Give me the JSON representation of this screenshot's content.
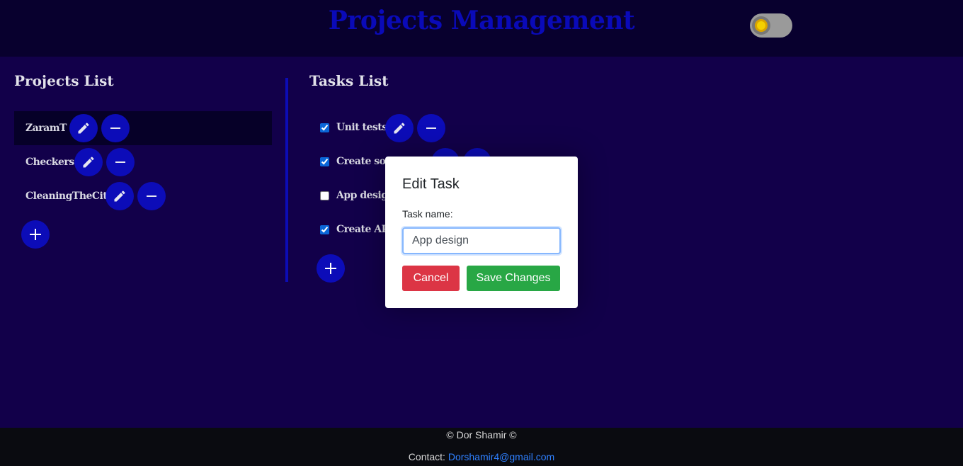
{
  "header": {
    "title": "Projects Management"
  },
  "theme_toggle": {
    "icon": "sun-icon",
    "state": "off"
  },
  "projects": {
    "title": "Projects List",
    "items": [
      {
        "label": "ZaramT",
        "selected": true
      },
      {
        "label": "Checkers",
        "selected": false
      },
      {
        "label": "CleaningTheCity",
        "selected": false
      }
    ],
    "add_icon": "plus-icon"
  },
  "tasks": {
    "title": "Tasks List",
    "items": [
      {
        "label": "Unit tests",
        "checked": true
      },
      {
        "label": "Create some",
        "checked": true
      },
      {
        "label": "App design",
        "checked": false
      },
      {
        "label": "Create API",
        "checked": true
      }
    ],
    "add_icon": "plus-icon"
  },
  "modal": {
    "title": "Edit Task",
    "field_label": "Task name:",
    "field_value": "App design",
    "cancel_label": "Cancel",
    "save_label": "Save Changes"
  },
  "footer": {
    "copyright": "© Dor Shamir ©",
    "contact_label": "Contact:",
    "contact_email": "Dorshamir4@gmail.com"
  },
  "colors": {
    "background": "#12004a",
    "header": "#08002e",
    "accent": "#0c0cb8",
    "cancel": "#dc3545",
    "save": "#28a745",
    "link": "#2f80ff"
  }
}
